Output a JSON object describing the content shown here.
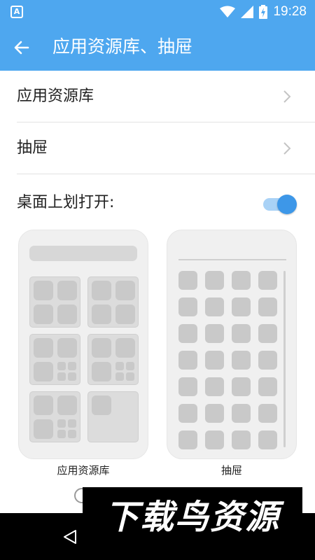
{
  "status_bar": {
    "app_icon_letter": "A",
    "time": "19:28"
  },
  "app_bar": {
    "title": "应用资源库、抽屉"
  },
  "settings": {
    "app_library_label": "应用资源库",
    "drawer_label": "抽屉",
    "swipe_up_label": "桌面上划打开:",
    "swipe_up_enabled": true
  },
  "options": {
    "app_library_caption": "应用资源库",
    "drawer_caption": "抽屉",
    "selected": "drawer"
  },
  "watermark": {
    "text": "下载鸟资源"
  },
  "colors": {
    "primary": "#4ea7ef",
    "toggle_thumb": "#3d97e8",
    "radio_selected": "#e8582a"
  }
}
